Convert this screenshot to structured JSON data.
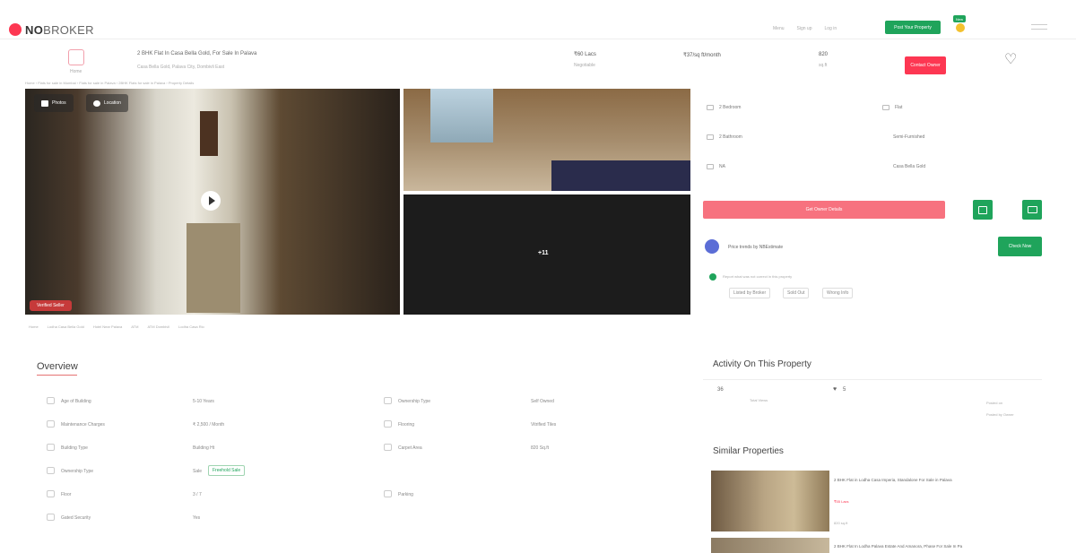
{
  "brand": {
    "name_bold": "NO",
    "name_light": "BROKER",
    "accent": "#fd3752",
    "green": "#1fa45b"
  },
  "header": {
    "right_links": [
      "Menu",
      "Sign up",
      "Log in"
    ],
    "post_button": "Post Your Property",
    "new_badge": "New"
  },
  "property": {
    "title": "2 BHK Flat In Casa Bella Gold, For Sale In Palava",
    "subtitle": "Casa Bella Gold, Palava City, Dombivli East",
    "price": "₹60 Lacs",
    "price_note": "Negotiable",
    "emi": "₹37/sq ft/month",
    "area": "820",
    "area_unit": "sq.ft",
    "contact_button": "Contact Owner",
    "home_label": "Home"
  },
  "breadcrumb": "Home  ›  Flats for sale in Mumbai  ›  Flats for sale in Palava  ›  2BHK Flats for sale in Palava  ›  Property Details",
  "gallery": {
    "photos_chip": "Photos",
    "location_chip": "Location",
    "more_count": "+11",
    "verified_chip": "Verified Seller"
  },
  "near": [
    "Home",
    "Lodha Casa Bella Gold",
    "Hotel Near Palava",
    "ATM",
    "ATM Dombivli",
    "Lodha Casa Rio"
  ],
  "specs": [
    {
      "icon": "bed-icon",
      "label": "2 Bedroom",
      "sub": ""
    },
    {
      "icon": "bath-icon",
      "label": "2 Bathroom",
      "sub": ""
    },
    {
      "icon": "balcony-icon",
      "label": "NA",
      "sub": ""
    },
    {
      "icon": "building-icon",
      "label": "Flat",
      "sub": ""
    },
    {
      "icon": "furnish-icon",
      "label": "Semi-Furnished",
      "sub": ""
    },
    {
      "icon": "society-icon",
      "label": "Casa Bella Gold",
      "sub": ""
    }
  ],
  "actions": {
    "main_button": "Get Owner Details"
  },
  "nobroker": {
    "title": "Price trends by NBEstimate",
    "button": "Check Now",
    "note": "Report what was not correct in this property",
    "tags": [
      "Listed by Broker",
      "Sold Out",
      "Wrong Info"
    ]
  },
  "overview": {
    "title": "Overview",
    "rows": [
      {
        "icon": "age-icon",
        "label": "Age of Building",
        "value": "5-10 Years"
      },
      {
        "icon": "maintenance-icon",
        "label": "Maintenance Charges",
        "value": "₹ 2,500 / Month"
      },
      {
        "icon": "building-type-icon",
        "label": "Building Type",
        "value": "Building Ht"
      },
      {
        "icon": "ownership-icon",
        "label": "Ownership Type",
        "value": "Sale",
        "badge": "Freehold Sale"
      },
      {
        "icon": "floor-icon",
        "label": "Floor",
        "value": "3 / 7"
      },
      {
        "icon": "gated-icon",
        "label": "Gated Security",
        "value": "Yes"
      }
    ],
    "rows_right": [
      {
        "icon": "ownership-type-icon",
        "label": "Ownership Type",
        "value": "Self Owned"
      },
      {
        "icon": "flooring-icon",
        "label": "Flooring",
        "value": "Vitrified Tiles"
      },
      {
        "icon": "carpet-icon",
        "label": "Carpet Area",
        "value": "820 Sq.ft"
      },
      {
        "icon": "parking-icon",
        "label": "Parking",
        "value": ""
      }
    ]
  },
  "activity": {
    "title": "Activity On This Property",
    "views": "36",
    "views_label": "Total Views",
    "shortlists": "5",
    "updated_label": "Posted on",
    "updated_value": "Posted by  Owner"
  },
  "similar": {
    "title": "Similar Properties",
    "items": [
      {
        "title": "2 BHK Flat in Lodha Casa Imperia, Standalone For Sale in Palava",
        "price": "₹55 Lacs",
        "meta": "820 sq.ft"
      },
      {
        "title": "2 BHK Flat In Lodha Palava Estate And Amanora, Phase For Sale In Pa",
        "price": "",
        "meta": ""
      }
    ]
  }
}
